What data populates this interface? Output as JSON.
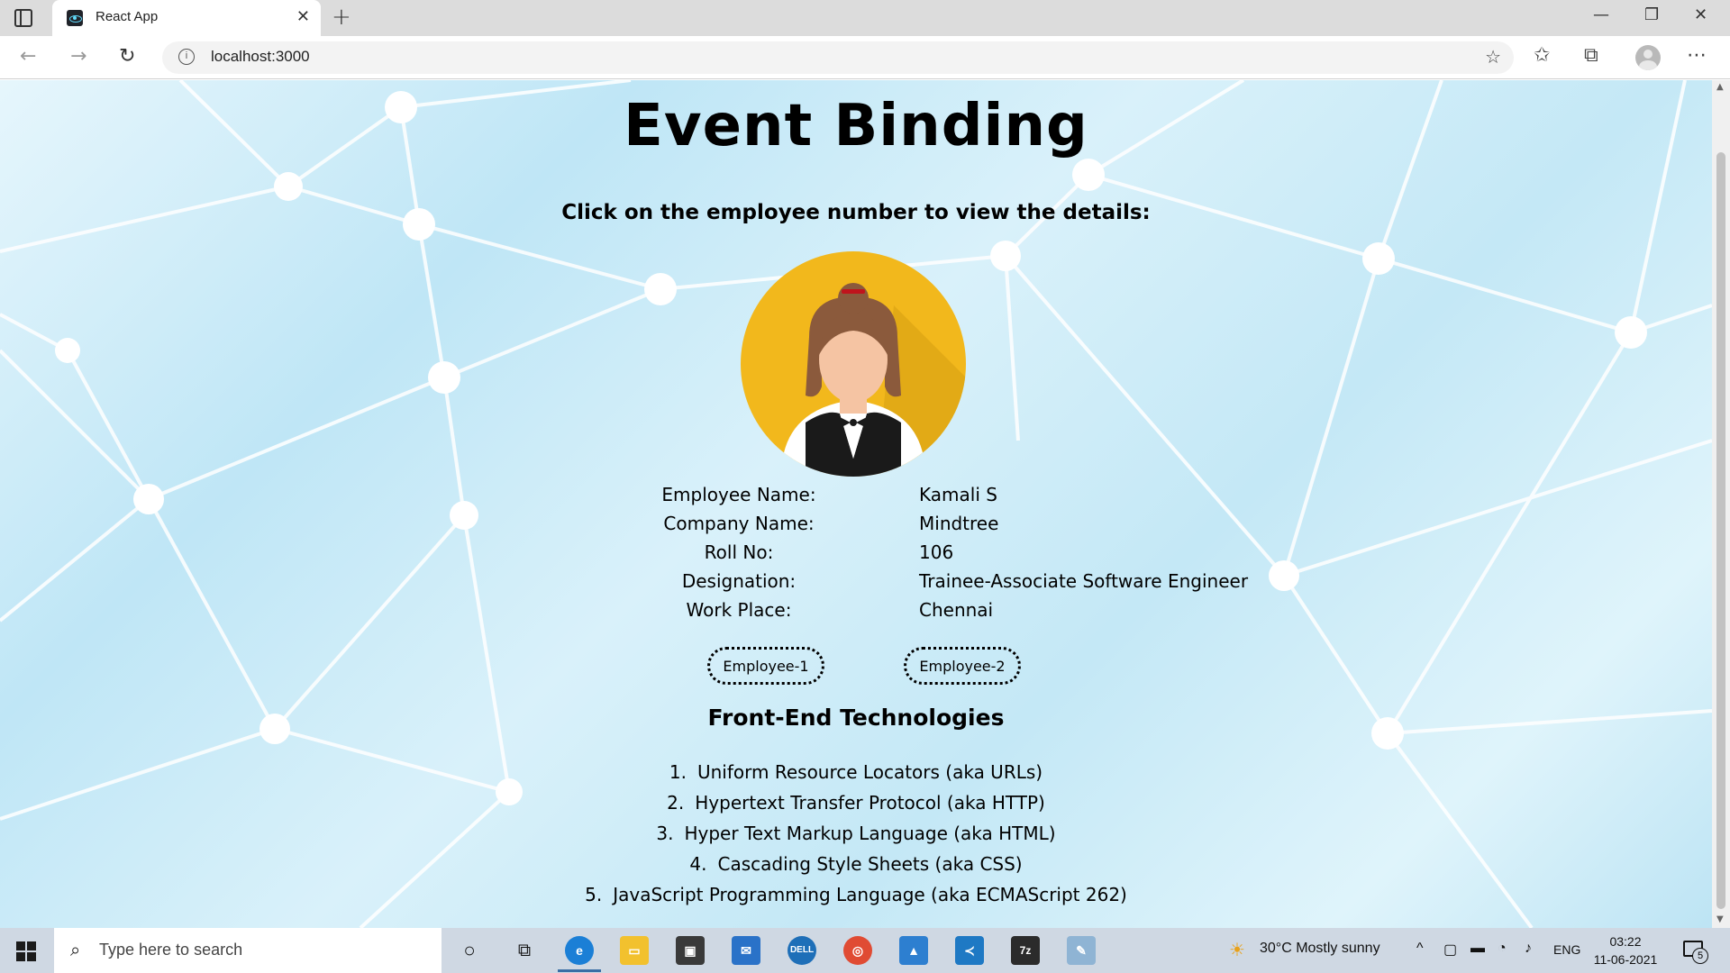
{
  "browser": {
    "tab_title": "React App",
    "url": "localhost:3000"
  },
  "page": {
    "title": "Event Binding",
    "instruction": "Click on the employee number to view the details:",
    "avatar_icon": "female-employee-avatar-icon",
    "details": [
      {
        "label": "Employee Name:",
        "value": "Kamali S"
      },
      {
        "label": "Company Name:",
        "value": "Mindtree"
      },
      {
        "label": "Roll No:",
        "value": "106"
      },
      {
        "label": "Designation:",
        "value": "Trainee-Associate Software Engineer"
      },
      {
        "label": "Work Place:",
        "value": "Chennai"
      }
    ],
    "buttons": {
      "employee_1": "Employee-1",
      "employee_2": "Employee-2"
    },
    "tech_heading": "Front-End Technologies",
    "tech_list": [
      {
        "num": "1.",
        "text": "Uniform Resource Locators (aka URLs)"
      },
      {
        "num": "2.",
        "text": "Hypertext Transfer Protocol (aka HTTP)"
      },
      {
        "num": "3.",
        "text": "Hyper Text Markup Language (aka HTML)"
      },
      {
        "num": "4.",
        "text": "Cascading Style Sheets (aka CSS)"
      },
      {
        "num": "5.",
        "text": "JavaScript Programming Language (aka ECMAScript 262)"
      }
    ]
  },
  "taskbar": {
    "search_placeholder": "Type here to search",
    "weather": "30°C  Mostly sunny",
    "language": "ENG",
    "time": "03:22",
    "date": "11-06-2021",
    "notification_count": "5"
  },
  "colors": {
    "avatar_bg": "#f2b81c",
    "taskbar_bg": "#cfd8e3",
    "page_bg": "#c4e8f6"
  }
}
